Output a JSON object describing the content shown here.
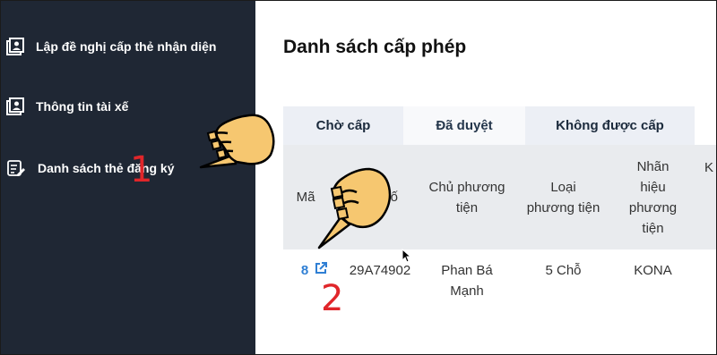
{
  "sidebar": {
    "items": [
      {
        "label": "Lập đề nghị cấp thẻ nhận diện",
        "icon": "contact-card-icon"
      },
      {
        "label": "Thông tin tài xế",
        "icon": "driver-profile-icon"
      },
      {
        "label": "Danh sách thẻ đăng ký",
        "icon": "list-edit-icon"
      }
    ]
  },
  "main": {
    "title": "Danh sách cấp phép",
    "tabs": [
      {
        "label": "Chờ cấp"
      },
      {
        "label": "Đã duyệt",
        "active": true
      },
      {
        "label": "Không được cấp"
      }
    ],
    "table": {
      "columns": [
        "Mã",
        "số",
        "Chủ phương\ntiện",
        "Loại\nphương tiện",
        "Nhãn\nhiệu\nphương\ntiện",
        "K"
      ],
      "rows": [
        {
          "ma": "8",
          "so": "29A74902",
          "chu": "Phan Bá\nMạnh",
          "loai": "5 Chỗ",
          "nhan_hieu": "KONA"
        }
      ]
    }
  },
  "annotations": {
    "step1": "1",
    "step2": "2"
  },
  "colors": {
    "sidebar_bg": "#1f2734",
    "link": "#2f7fd4",
    "step_number": "#e0262a",
    "hand": "#f6c770"
  }
}
